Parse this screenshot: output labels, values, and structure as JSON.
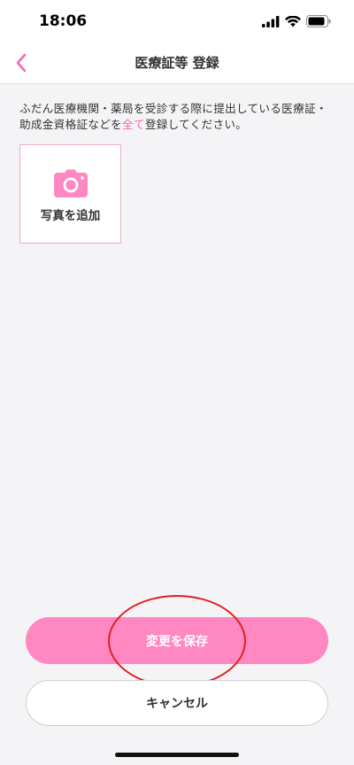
{
  "status_bar": {
    "time": "18:06",
    "icons": [
      "signal-icon",
      "wifi-icon",
      "battery-icon"
    ]
  },
  "header": {
    "title": "医療証等 登録",
    "back_icon": "chevron-left-icon"
  },
  "main": {
    "instruction_before": "ふだん医療機関・薬局を受診する際に提出している医療証・助成金資格証などを",
    "instruction_highlight": "全て",
    "instruction_after": "登録してください。",
    "add_photo_label": "写真を追加",
    "add_photo_icon": "camera-icon"
  },
  "actions": {
    "save_label": "変更を保存",
    "cancel_label": "キャンセル"
  },
  "colors": {
    "accent": "#ff88c2",
    "highlight_text": "#ef6ab5",
    "annotation_red": "#e02020"
  }
}
